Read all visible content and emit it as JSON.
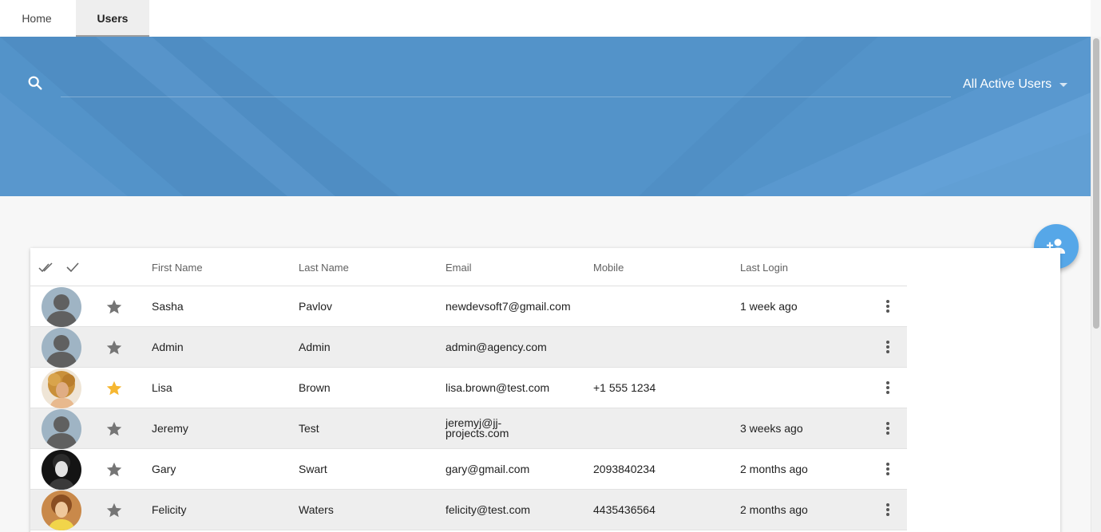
{
  "tabs": {
    "home": "Home",
    "users": "Users"
  },
  "search": {
    "placeholder": "",
    "value": ""
  },
  "filter": {
    "label": "All Active Users"
  },
  "table": {
    "headers": {
      "first_name": "First Name",
      "last_name": "Last Name",
      "email": "Email",
      "mobile": "Mobile",
      "last_login": "Last Login"
    },
    "rows": [
      {
        "first_name": "Sasha",
        "last_name": "Pavlov",
        "email": "newdevsoft7@gmail.com",
        "mobile": "",
        "last_login": "1 week ago",
        "starred": false,
        "avatar": "placeholder"
      },
      {
        "first_name": "Admin",
        "last_name": "Admin",
        "email": "admin@agency.com",
        "mobile": "",
        "last_login": "",
        "starred": false,
        "avatar": "placeholder"
      },
      {
        "first_name": "Lisa",
        "last_name": "Brown",
        "email": "lisa.brown@test.com",
        "mobile": "+1 555 1234",
        "last_login": "",
        "starred": true,
        "avatar": "photo-curly-hair"
      },
      {
        "first_name": "Jeremy",
        "last_name": "Test",
        "email": "jeremyj@jj-projects.com",
        "email_lines": [
          "jeremyj@jj-",
          "projects.com"
        ],
        "mobile": "",
        "last_login": "3 weeks ago",
        "starred": false,
        "avatar": "placeholder"
      },
      {
        "first_name": "Gary",
        "last_name": "Swart",
        "email": "gary@gmail.com",
        "mobile": "2093840234",
        "last_login": "2 months ago",
        "starred": false,
        "avatar": "photo-dark"
      },
      {
        "first_name": "Felicity",
        "last_name": "Waters",
        "email": "felicity@test.com",
        "mobile": "4435436564",
        "last_login": "2 months ago",
        "starred": false,
        "avatar": "photo-warm"
      }
    ]
  },
  "colors": {
    "hero": "#5393c9",
    "fab": "#56a7e8",
    "star_active": "#f6b731",
    "star_inactive": "#757575"
  }
}
